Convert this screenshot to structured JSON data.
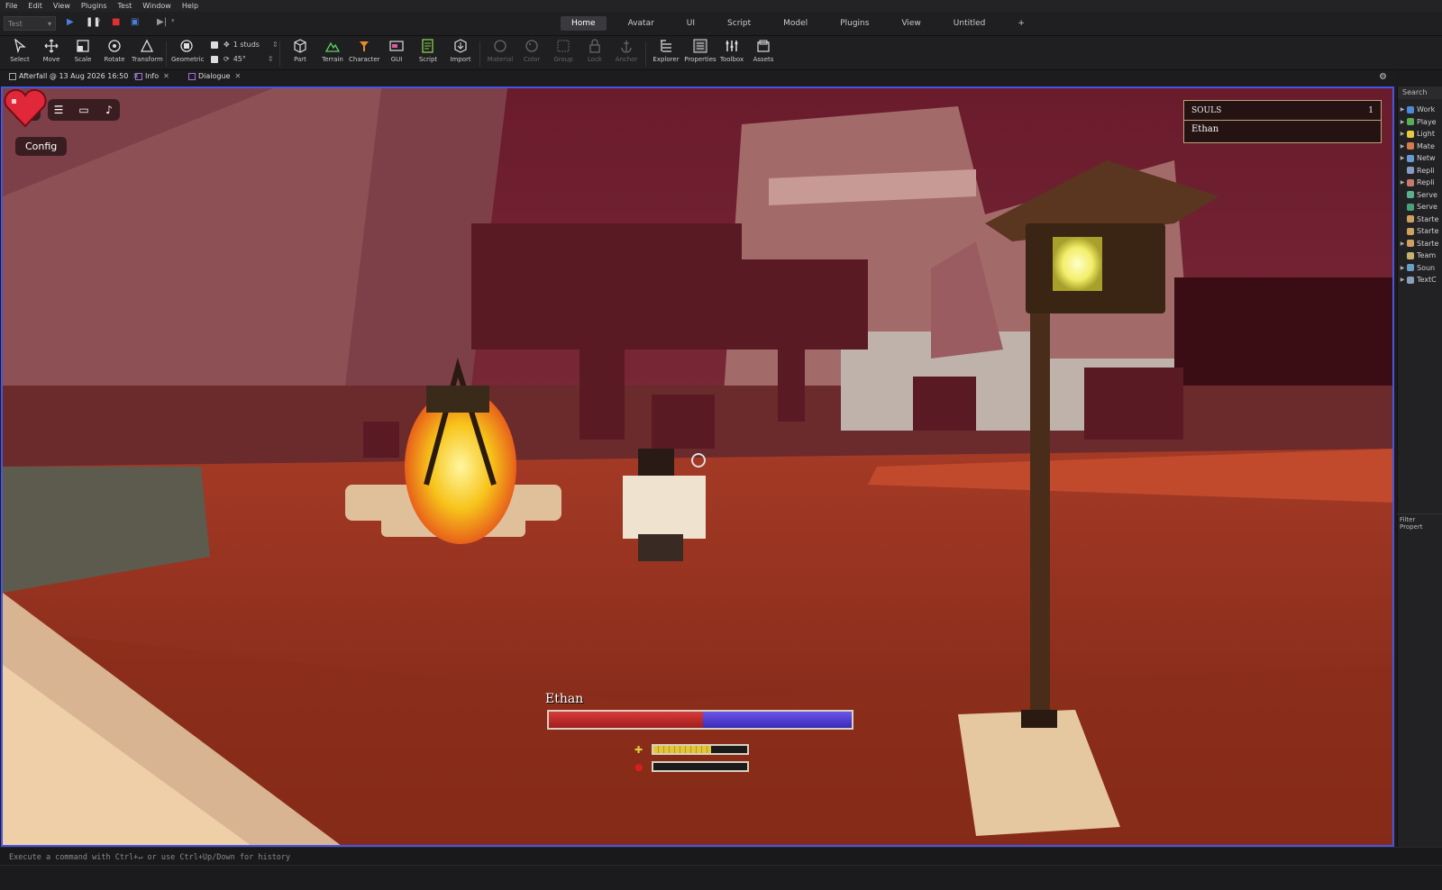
{
  "menubar": {
    "items": [
      "File",
      "Edit",
      "View",
      "Plugins",
      "Test",
      "Window",
      "Help"
    ]
  },
  "topbar": {
    "mode": "Test",
    "tabs": [
      "Home",
      "Avatar",
      "UI",
      "Script",
      "Model",
      "Plugins",
      "View",
      "Untitled",
      "+"
    ],
    "active_tab": "Home"
  },
  "ribbon": {
    "tools": [
      "Select",
      "Move",
      "Scale",
      "Rotate",
      "Transform",
      "Geometric",
      "Part",
      "Terrain",
      "Character",
      "GUI",
      "Script",
      "Import",
      "Material",
      "Color",
      "Group",
      "Lock",
      "Anchor",
      "Explorer",
      "Properties",
      "Toolbox",
      "Assets"
    ],
    "move_snap": "1 studs",
    "rotate_snap": "45°"
  },
  "doc_tabs": [
    {
      "label": "Afterfall @ 13 Aug 2026 16:50"
    },
    {
      "label": "Info"
    },
    {
      "label": "Dialogue"
    }
  ],
  "game": {
    "config_label": "Config",
    "souls_title": "SOULS",
    "souls_count": "1",
    "souls_player": "Ethan",
    "player_name": "Ethan",
    "health_fraction": 0.51,
    "stamina_fraction": 0.62,
    "blood_fraction": 0.0,
    "colors": {
      "health": "#c22a2a",
      "mana": "#5240d8",
      "stamina": "#e3c63a",
      "selection_border": "#4855e0"
    }
  },
  "explorer": {
    "search_label": "Search",
    "items": [
      "Work",
      "Playe",
      "Light",
      "Mate",
      "Netw",
      "Repli",
      "Repli",
      "Serve",
      "Serve",
      "Starte",
      "Starte",
      "Starte",
      "Team",
      "Soun",
      "TextC"
    ],
    "filter_label": "Filter Propert"
  },
  "command_bar": {
    "placeholder": "Execute a command with Ctrl+↵ or use Ctrl+Up/Down for history"
  }
}
